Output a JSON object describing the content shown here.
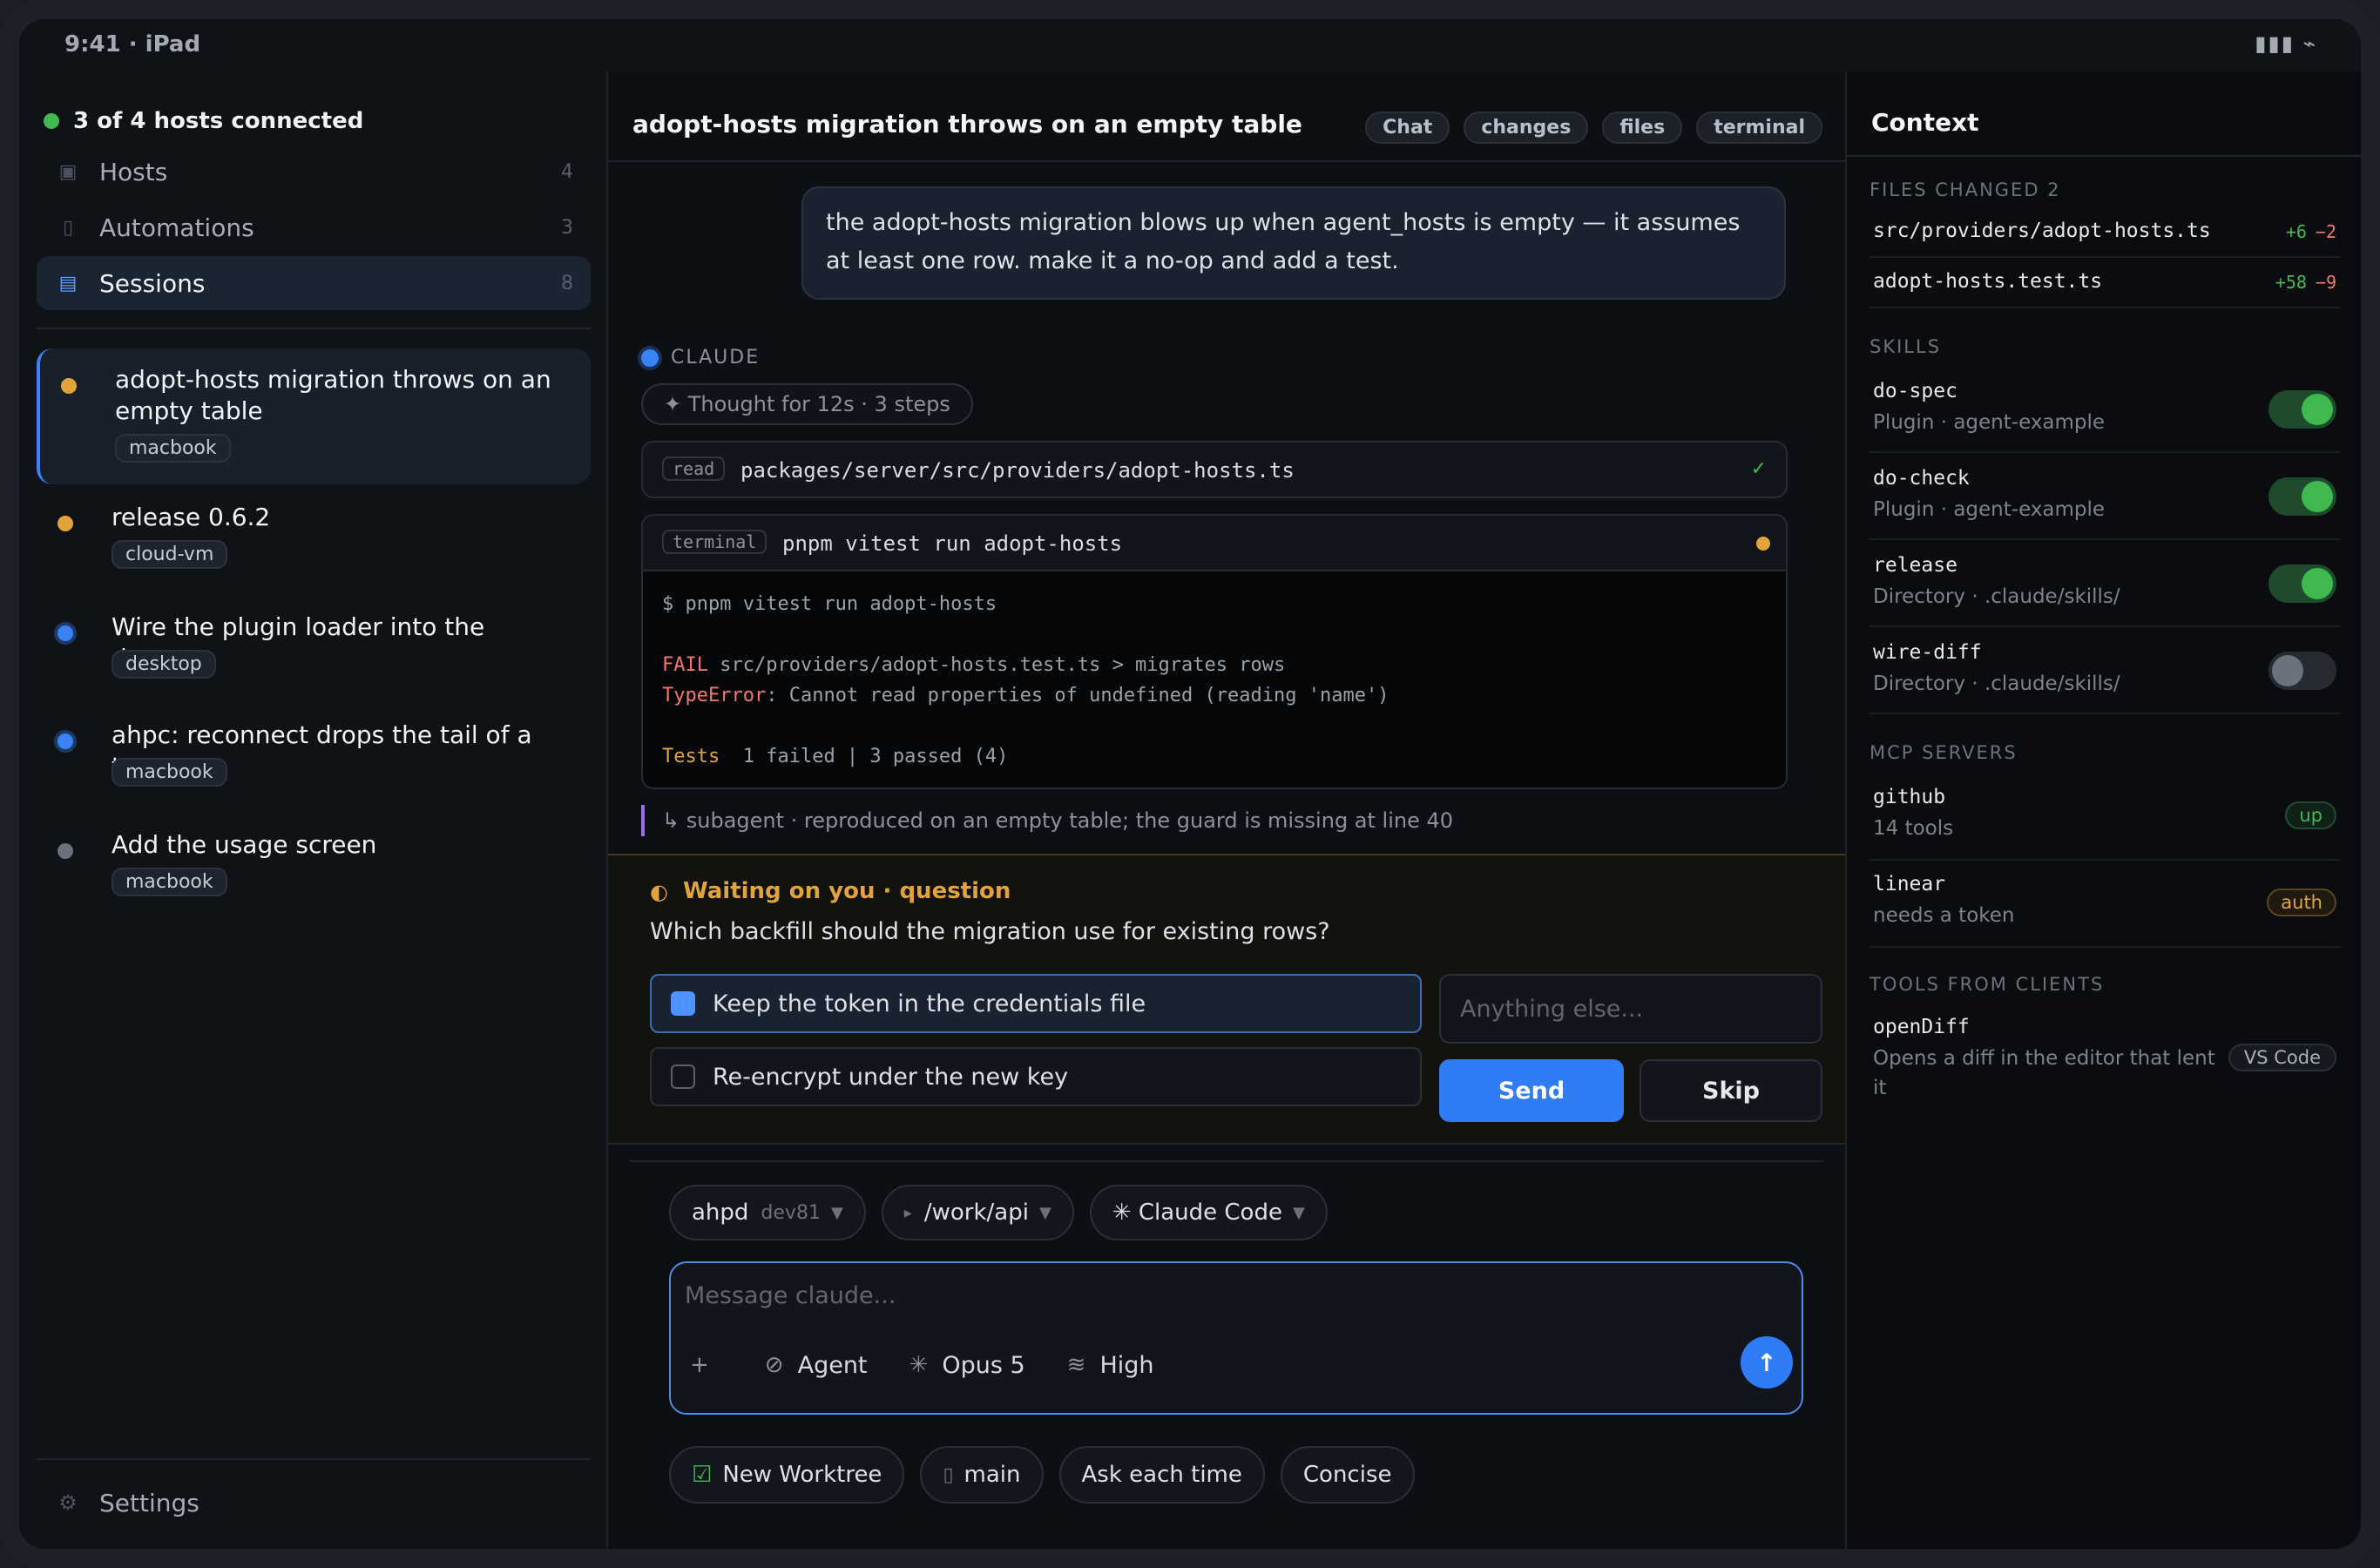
{
  "status_bar": {
    "time": "9:41 · iPad",
    "icons": "▮▮▮ ⌁"
  },
  "sidebar": {
    "hosts_status": "3 of 4 hosts connected",
    "nav": [
      {
        "label": "Hosts",
        "count": "4",
        "icon": "server-icon",
        "glyph": "▣"
      },
      {
        "label": "Automations",
        "count": "3",
        "icon": "automation-icon",
        "glyph": "▯"
      },
      {
        "label": "Sessions",
        "count": "8",
        "icon": "sessions-icon",
        "glyph": "▤"
      }
    ],
    "sessions": [
      {
        "title": "adopt-hosts migration throws on an empty table",
        "host": "macbook",
        "status_color": "#e3a33b"
      },
      {
        "title": "release 0.6.2",
        "host": "cloud-vm",
        "status_color": "#e3a33b"
      },
      {
        "title": "Wire the plugin loader into the daemon",
        "host": "desktop",
        "status_color": "#3b82f6"
      },
      {
        "title": "ahpc: reconnect drops the tail of a turn",
        "host": "macbook",
        "status_color": "#3b82f6"
      },
      {
        "title": "Add the usage screen",
        "host": "macbook",
        "status_color": "#6b727c"
      }
    ],
    "settings_label": "Settings"
  },
  "main": {
    "title": "adopt-hosts migration throws on an empty table",
    "tabs": [
      "Chat",
      "changes",
      "files",
      "terminal"
    ],
    "user_message": "the adopt-hosts migration blows up when agent_hosts is empty — it assumes at least one row. make it a no-op and add a test.",
    "assistant_name": "CLAUDE",
    "thought": "✦ Thought for 12s · 3 steps",
    "read_tool": {
      "kind": "read",
      "path": "packages/server/src/providers/adopt-hosts.ts",
      "status": "✓"
    },
    "terminal_tool": {
      "kind": "terminal",
      "command": "pnpm vitest run adopt-hosts",
      "prompt_line": "$ pnpm vitest run adopt-hosts",
      "fail_label": "FAIL",
      "fail_text": " src/providers/adopt-hosts.test.ts > migrates rows",
      "error_label": "TypeError",
      "error_text": ": Cannot read properties of undefined (reading 'name')",
      "tests_label": "Tests",
      "tests_text": "  1 failed | 3 passed (4)"
    },
    "subagent": "↳ subagent · reproduced on an empty table; the guard is missing at line 40",
    "question": {
      "icon": "◐",
      "title": "Waiting on you · question",
      "text": "Which backfill should the migration use for existing rows?",
      "options": [
        {
          "label": "Keep the token in the credentials file",
          "selected": true
        },
        {
          "label": "Re-encrypt under the new key",
          "selected": false
        }
      ],
      "input_placeholder": "Anything else...",
      "send_label": "Send",
      "skip_label": "Skip"
    },
    "composer": {
      "host": "ahpd",
      "host_sub": "dev81",
      "path": "/work/api",
      "agent_kind": "✳ Claude Code",
      "placeholder": "Message claude...",
      "tools": [
        {
          "icon": "+",
          "label": ""
        },
        {
          "icon": "⊘",
          "label": "Agent"
        },
        {
          "icon": "✳",
          "label": "Opus 5"
        },
        {
          "icon": "≋",
          "label": "High"
        }
      ],
      "send_icon": "↑",
      "bottom_chips": [
        {
          "icon": "☑",
          "label": "New Worktree"
        },
        {
          "icon": "▯",
          "label": "main"
        },
        {
          "icon": "",
          "label": "Ask each time"
        },
        {
          "icon": "",
          "label": "Concise"
        }
      ]
    }
  },
  "context": {
    "title": "Context",
    "files_header": "FILES CHANGED 2",
    "files": [
      {
        "name": "src/providers/adopt-hosts.ts",
        "add": "+6",
        "del": "−2"
      },
      {
        "name": "adopt-hosts.test.ts",
        "add": "+58",
        "del": "−9"
      }
    ],
    "skills_header": "SKILLS",
    "skills": [
      {
        "name": "do-spec",
        "desc": "Plugin · agent-example",
        "enabled": true
      },
      {
        "name": "do-check",
        "desc": "Plugin · agent-example",
        "enabled": true
      },
      {
        "name": "release",
        "desc": "Directory · .claude/skills/",
        "enabled": true
      },
      {
        "name": "wire-diff",
        "desc": "Directory · .claude/skills/",
        "enabled": false
      }
    ],
    "mcp_header": "MCP SERVERS",
    "mcp": [
      {
        "name": "github",
        "desc": "14 tools",
        "status": "up"
      },
      {
        "name": "linear",
        "desc": "needs a token",
        "status": "auth"
      }
    ],
    "tools_header": "TOOLS FROM CLIENTS",
    "client_tools": [
      {
        "name": "openDiff",
        "desc": "Opens a diff in the editor that lent it",
        "client": "VS Code"
      }
    ]
  },
  "colors": {
    "accent": "#2f7cf6",
    "waiting": "#e3a33b",
    "ok": "#3fb950",
    "error": "#f0786b"
  }
}
